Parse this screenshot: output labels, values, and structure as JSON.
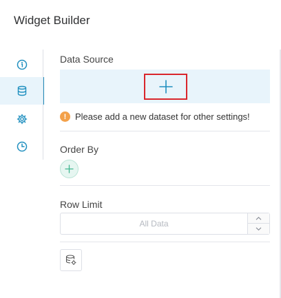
{
  "header": {
    "title": "Widget Builder"
  },
  "rail": {
    "items": [
      {
        "icon": "info-icon",
        "active": false
      },
      {
        "icon": "database-icon",
        "active": true
      },
      {
        "icon": "gear-icon",
        "active": false
      },
      {
        "icon": "clock-icon",
        "active": false
      }
    ]
  },
  "data_source": {
    "label": "Data Source",
    "add_icon": "plus-icon",
    "warning_text": "Please add a new dataset for other settings!"
  },
  "order_by": {
    "label": "Order By",
    "add_icon": "plus-icon"
  },
  "row_limit": {
    "label": "Row Limit",
    "placeholder": "All Data"
  },
  "dataset_button": {
    "icon": "dataset-settings-icon"
  },
  "colors": {
    "accent": "#1f8fbf",
    "panel_bg": "#e8f4fb",
    "highlight_border": "#d9252b",
    "warning": "#f3a14a",
    "order_add_bg": "#e6f6f1"
  }
}
